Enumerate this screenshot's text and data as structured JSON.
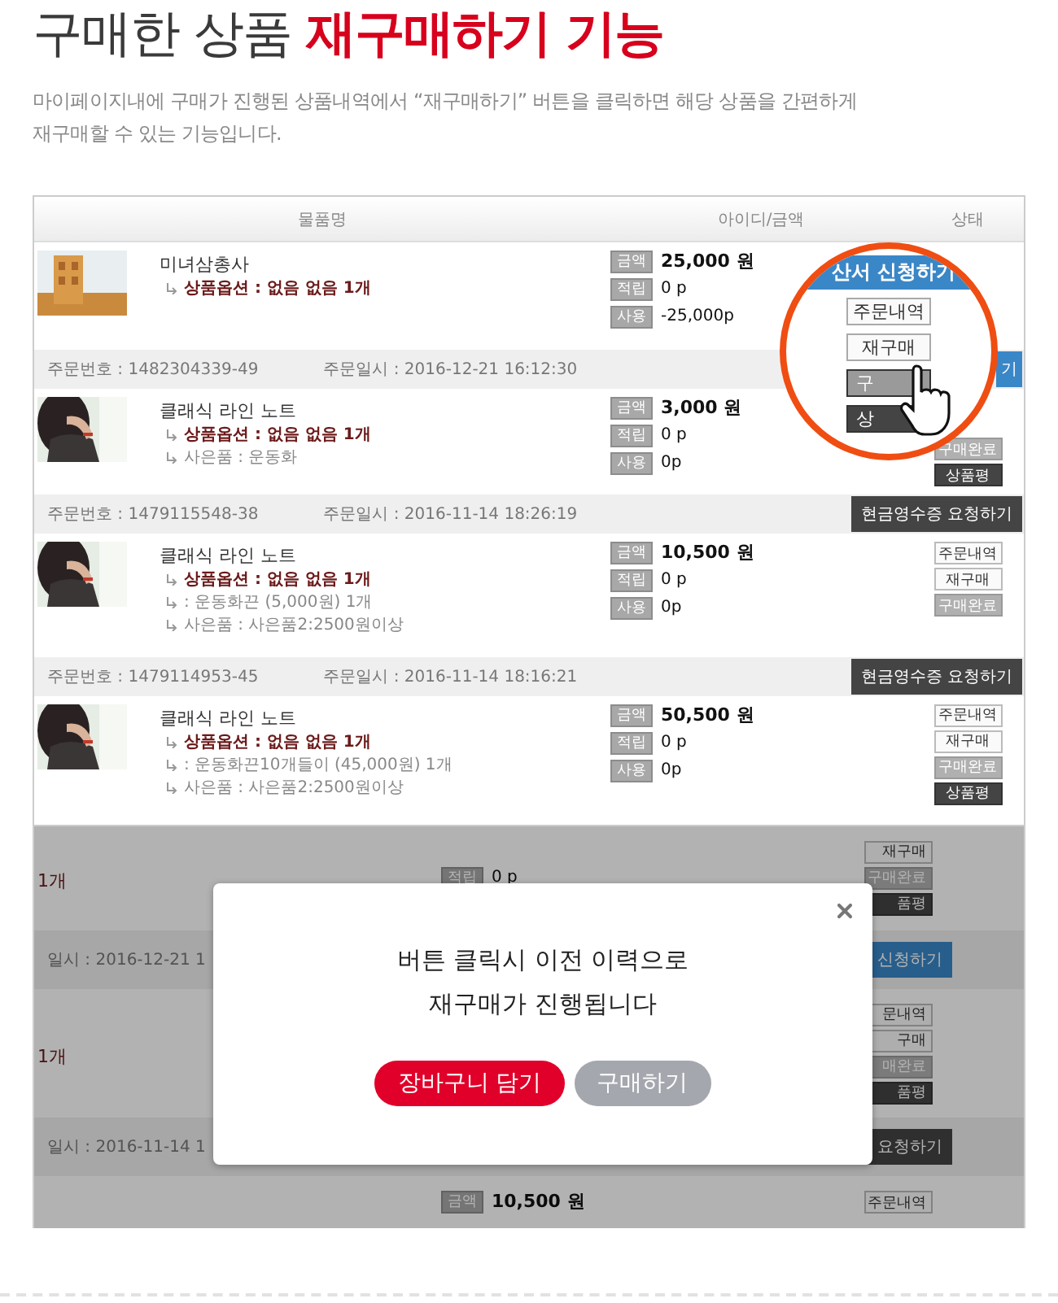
{
  "title": {
    "plain": "구매한 상품",
    "highlight": "재구매하기 기능"
  },
  "description": [
    "마이페이지내에 구매가 진행된 상품내역에서 “재구매하기” 버튼을 클릭하면 해당 상품을 간편하게",
    "재구매할 수 있는 기능입니다."
  ],
  "list_screen": {
    "columns": [
      "물품명",
      "아이디/금액",
      "상태"
    ],
    "rows": [
      {
        "kind": "product",
        "thumb": {
          "kind": "picture"
        },
        "name": "미녀삼총사",
        "options": [
          {
            "kind": "option",
            "text": "상품옵션 : 없음 없음 1개"
          }
        ],
        "amounts": [
          {
            "label": "금액",
            "value": "25,000 원",
            "strong": true
          },
          {
            "label": "적립",
            "value": "0 p",
            "strong": false
          },
          {
            "label": "사용",
            "value": "-25,000p",
            "strong": false
          }
        ]
      },
      {
        "kind": "bar",
        "number": "주문번호 : 1482304339-49",
        "date": "주문일시 : 2016-12-21 16:12:30",
        "action": {
          "label": "기",
          "kind": "blue"
        }
      },
      {
        "kind": "product",
        "thumb": {
          "kind": "picture"
        },
        "name": "클래식 라인 노트",
        "options": [
          {
            "kind": "option",
            "text": "상품옵션 : 없음 없음 1개"
          },
          {
            "kind": "plain",
            "text": "사은품 : 운동화"
          }
        ],
        "amounts": [
          {
            "label": "금액",
            "value": "3,000 원",
            "strong": true
          },
          {
            "label": "적립",
            "value": "0 p",
            "strong": false
          },
          {
            "label": "사용",
            "value": "0p",
            "strong": false
          }
        ],
        "status_buttons": [
          {
            "label": "구매완료",
            "kind": "grey"
          },
          {
            "label": "상품평",
            "kind": "dark"
          }
        ]
      },
      {
        "kind": "bar",
        "number": "주문번호 : 1479115548-38",
        "date": "주문일시 : 2016-11-14 18:26:19",
        "action": {
          "label": "현금영수증 요청하기",
          "kind": "dark"
        }
      },
      {
        "kind": "product",
        "thumb": {
          "kind": "picture"
        },
        "name": "클래식 라인 노트",
        "options": [
          {
            "kind": "option",
            "text": "상품옵션 : 없음 없음 1개"
          },
          {
            "kind": "plain",
            "text": ": 운동화끈 (5,000원) 1개"
          },
          {
            "kind": "plain",
            "text": "사은품 : 사은품2:2500원이상"
          }
        ],
        "amounts": [
          {
            "label": "금액",
            "value": "10,500 원",
            "strong": true
          },
          {
            "label": "적립",
            "value": "0 p",
            "strong": false
          },
          {
            "label": "사용",
            "value": "0p",
            "strong": false
          }
        ],
        "status_buttons": [
          {
            "label": "주문내역",
            "kind": "outline"
          },
          {
            "label": "재구매",
            "kind": "outline"
          },
          {
            "label": "구매완료",
            "kind": "grey"
          }
        ]
      },
      {
        "kind": "bar",
        "number": "주문번호 : 1479114953-45",
        "date": "주문일시 : 2016-11-14 18:16:21",
        "action": {
          "label": "현금영수증 요청하기",
          "kind": "dark"
        }
      },
      {
        "kind": "product",
        "thumb": {
          "kind": "picture"
        },
        "name": "클래식 라인 노트",
        "options": [
          {
            "kind": "option",
            "text": "상품옵션 : 없음 없음 1개"
          },
          {
            "kind": "plain",
            "text": ": 운동화끈10개들이 (45,000원) 1개"
          },
          {
            "kind": "plain",
            "text": "사은품 : 사은품2:2500원이상"
          }
        ],
        "amounts": [
          {
            "label": "금액",
            "value": "50,500 원",
            "strong": true
          },
          {
            "label": "적립",
            "value": "0 p",
            "strong": false
          },
          {
            "label": "사용",
            "value": "0p",
            "strong": false
          }
        ],
        "status_buttons": [
          {
            "label": "주문내역",
            "kind": "outline"
          },
          {
            "label": "재구매",
            "kind": "outline"
          },
          {
            "label": "구매완료",
            "kind": "grey"
          },
          {
            "label": "상품평",
            "kind": "dark"
          }
        ]
      }
    ],
    "magnifier": {
      "top_button": "산서 신청하기",
      "buttons": [
        {
          "label": "주문내역",
          "kind": "outline"
        },
        {
          "label": "재구매",
          "kind": "outline"
        },
        {
          "label": "구",
          "kind": "grey"
        },
        {
          "label": "상",
          "kind": "dark"
        }
      ]
    }
  },
  "dimmed_screen": {
    "rows": [
      {
        "kind": "product",
        "left": "1개",
        "amounts": [
          {
            "label": "적립",
            "value": "0 p",
            "strong": false
          }
        ],
        "status_buttons": [
          {
            "label": "재구매",
            "kind": "outline"
          },
          {
            "label": "구매완료",
            "kind": "grey"
          },
          {
            "label": "품평",
            "kind": "dark"
          }
        ]
      },
      {
        "kind": "bar",
        "left": "일시 : 2016-12-21 1",
        "action": {
          "label": "신청하기",
          "kind": "blue"
        }
      },
      {
        "kind": "product",
        "left": "1개",
        "status_buttons": [
          {
            "label": "문내역",
            "kind": "outline"
          },
          {
            "label": "구매",
            "kind": "outline"
          },
          {
            "label": "매완료",
            "kind": "grey"
          },
          {
            "label": "품평",
            "kind": "dark"
          }
        ]
      },
      {
        "kind": "bar",
        "left": "일시 : 2016-11-14 1",
        "action": {
          "label": "요청하기",
          "kind": "dark"
        }
      },
      {
        "kind": "product",
        "amounts": [
          {
            "label": "금액",
            "value": "10,500 원",
            "strong": true
          }
        ],
        "status_buttons": [
          {
            "label": "주문내역",
            "kind": "outline"
          }
        ]
      }
    ],
    "modal": {
      "message": [
        "버튼 클릭시 이전 이력으로",
        "재구매가 진행됩니다"
      ],
      "buttons": [
        {
          "label": "장바구니 담기",
          "kind": "primary"
        },
        {
          "label": "구매하기",
          "kind": "secondary"
        }
      ]
    }
  }
}
